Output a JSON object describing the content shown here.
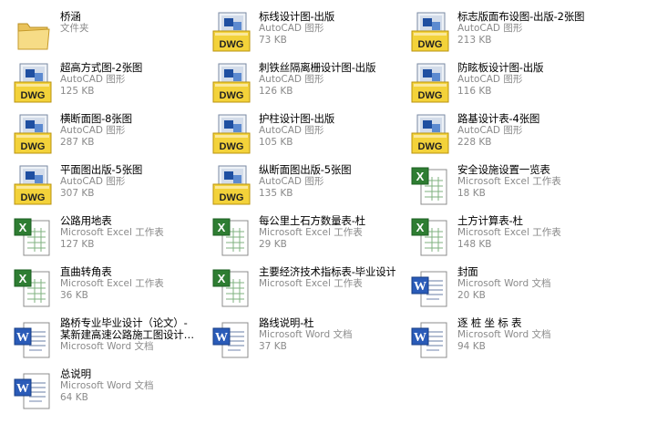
{
  "files": [
    {
      "name": "桥涵",
      "type": "文件夹",
      "size": "",
      "icon": "folder-icon"
    },
    {
      "name": "标线设计图-出版",
      "type": "AutoCAD 图形",
      "size": "73 KB",
      "icon": "dwg-file-icon"
    },
    {
      "name": "标志版面布设图-出版-2张图",
      "type": "AutoCAD 图形",
      "size": "213 KB",
      "icon": "dwg-file-icon"
    },
    {
      "name": "超高方式图-2张图",
      "type": "AutoCAD 图形",
      "size": "125 KB",
      "icon": "dwg-file-icon"
    },
    {
      "name": "刺铁丝隔离栅设计图-出版",
      "type": "AutoCAD 图形",
      "size": "126 KB",
      "icon": "dwg-file-icon"
    },
    {
      "name": "防眩板设计图-出版",
      "type": "AutoCAD 图形",
      "size": "116 KB",
      "icon": "dwg-file-icon"
    },
    {
      "name": "横断面图-8张图",
      "type": "AutoCAD 图形",
      "size": "287 KB",
      "icon": "dwg-file-icon"
    },
    {
      "name": "护柱设计图-出版",
      "type": "AutoCAD 图形",
      "size": "105 KB",
      "icon": "dwg-file-icon"
    },
    {
      "name": "路基设计表-4张图",
      "type": "AutoCAD 图形",
      "size": "228 KB",
      "icon": "dwg-file-icon"
    },
    {
      "name": "平面图出版-5张图",
      "type": "AutoCAD 图形",
      "size": "307 KB",
      "icon": "dwg-file-icon"
    },
    {
      "name": "纵断面图出版-5张图",
      "type": "AutoCAD 图形",
      "size": "135 KB",
      "icon": "dwg-file-icon"
    },
    {
      "name": "安全设施设置一览表",
      "type": "Microsoft Excel 工作表",
      "size": "18 KB",
      "icon": "excel-file-icon"
    },
    {
      "name": "公路用地表",
      "type": "Microsoft Excel 工作表",
      "size": "127 KB",
      "icon": "excel-file-icon"
    },
    {
      "name": "每公里土石方数量表-杜",
      "type": "Microsoft Excel 工作表",
      "size": "29 KB",
      "icon": "excel-file-icon"
    },
    {
      "name": "土方计算表-杜",
      "type": "Microsoft Excel 工作表",
      "size": "148 KB",
      "icon": "excel-file-icon"
    },
    {
      "name": "直曲转角表",
      "type": "Microsoft Excel 工作表",
      "size": "36 KB",
      "icon": "excel-file-icon"
    },
    {
      "name": "主要经济技术指标表-毕业设计",
      "type": "Microsoft Excel 工作表",
      "size": "",
      "icon": "excel-file-icon"
    },
    {
      "name": "封面",
      "type": "Microsoft Word 文档",
      "size": "20 KB",
      "icon": "word-file-icon"
    },
    {
      "name": "路桥专业毕业设计（论文）-某新建高速公路施工图设计…",
      "type": "Microsoft Word 文档",
      "size": "",
      "icon": "word-file-icon"
    },
    {
      "name": "路线说明-杜",
      "type": "Microsoft Word 文档",
      "size": "37 KB",
      "icon": "word-file-icon"
    },
    {
      "name": "逐 桩 坐 标 表",
      "type": "Microsoft Word 文档",
      "size": "94 KB",
      "icon": "word-file-icon"
    },
    {
      "name": "总说明",
      "type": "Microsoft Word 文档",
      "size": "64 KB",
      "icon": "word-file-icon"
    }
  ]
}
